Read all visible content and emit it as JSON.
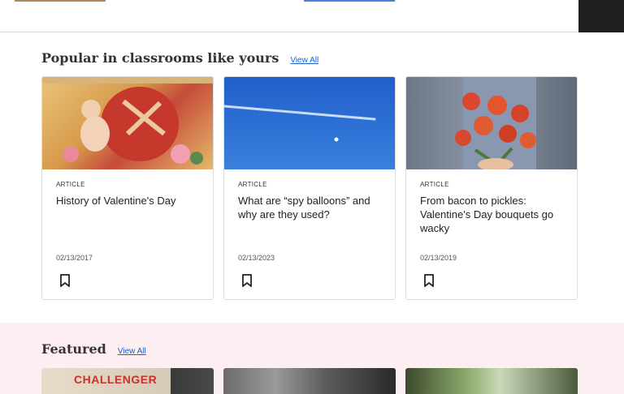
{
  "popular": {
    "title": "Popular in classrooms like yours",
    "view_all": "View All",
    "cards": [
      {
        "type": "ARTICLE",
        "title": "History of Valentine's Day",
        "date": "02/13/2017",
        "image": "valentine-cupid-illustration",
        "bookmark_icon": "bookmark-icon"
      },
      {
        "type": "ARTICLE",
        "title": "What are “spy balloons” and why are they used?",
        "date": "02/13/2023",
        "image": "blue-sky-balloon-photo",
        "bookmark_icon": "bookmark-icon"
      },
      {
        "type": "ARTICLE",
        "title": "From bacon to pickles: Valentine's Day bouquets go wacky",
        "date": "02/13/2019",
        "image": "rose-bouquet-photo",
        "bookmark_icon": "bookmark-icon"
      }
    ]
  },
  "featured": {
    "title": "Featured",
    "view_all": "View All",
    "banner_text": "CHALLENGER"
  },
  "colors": {
    "link": "#1a5fcf",
    "featured_band": "#fdeef1",
    "card_border": "#dcdcdc"
  }
}
